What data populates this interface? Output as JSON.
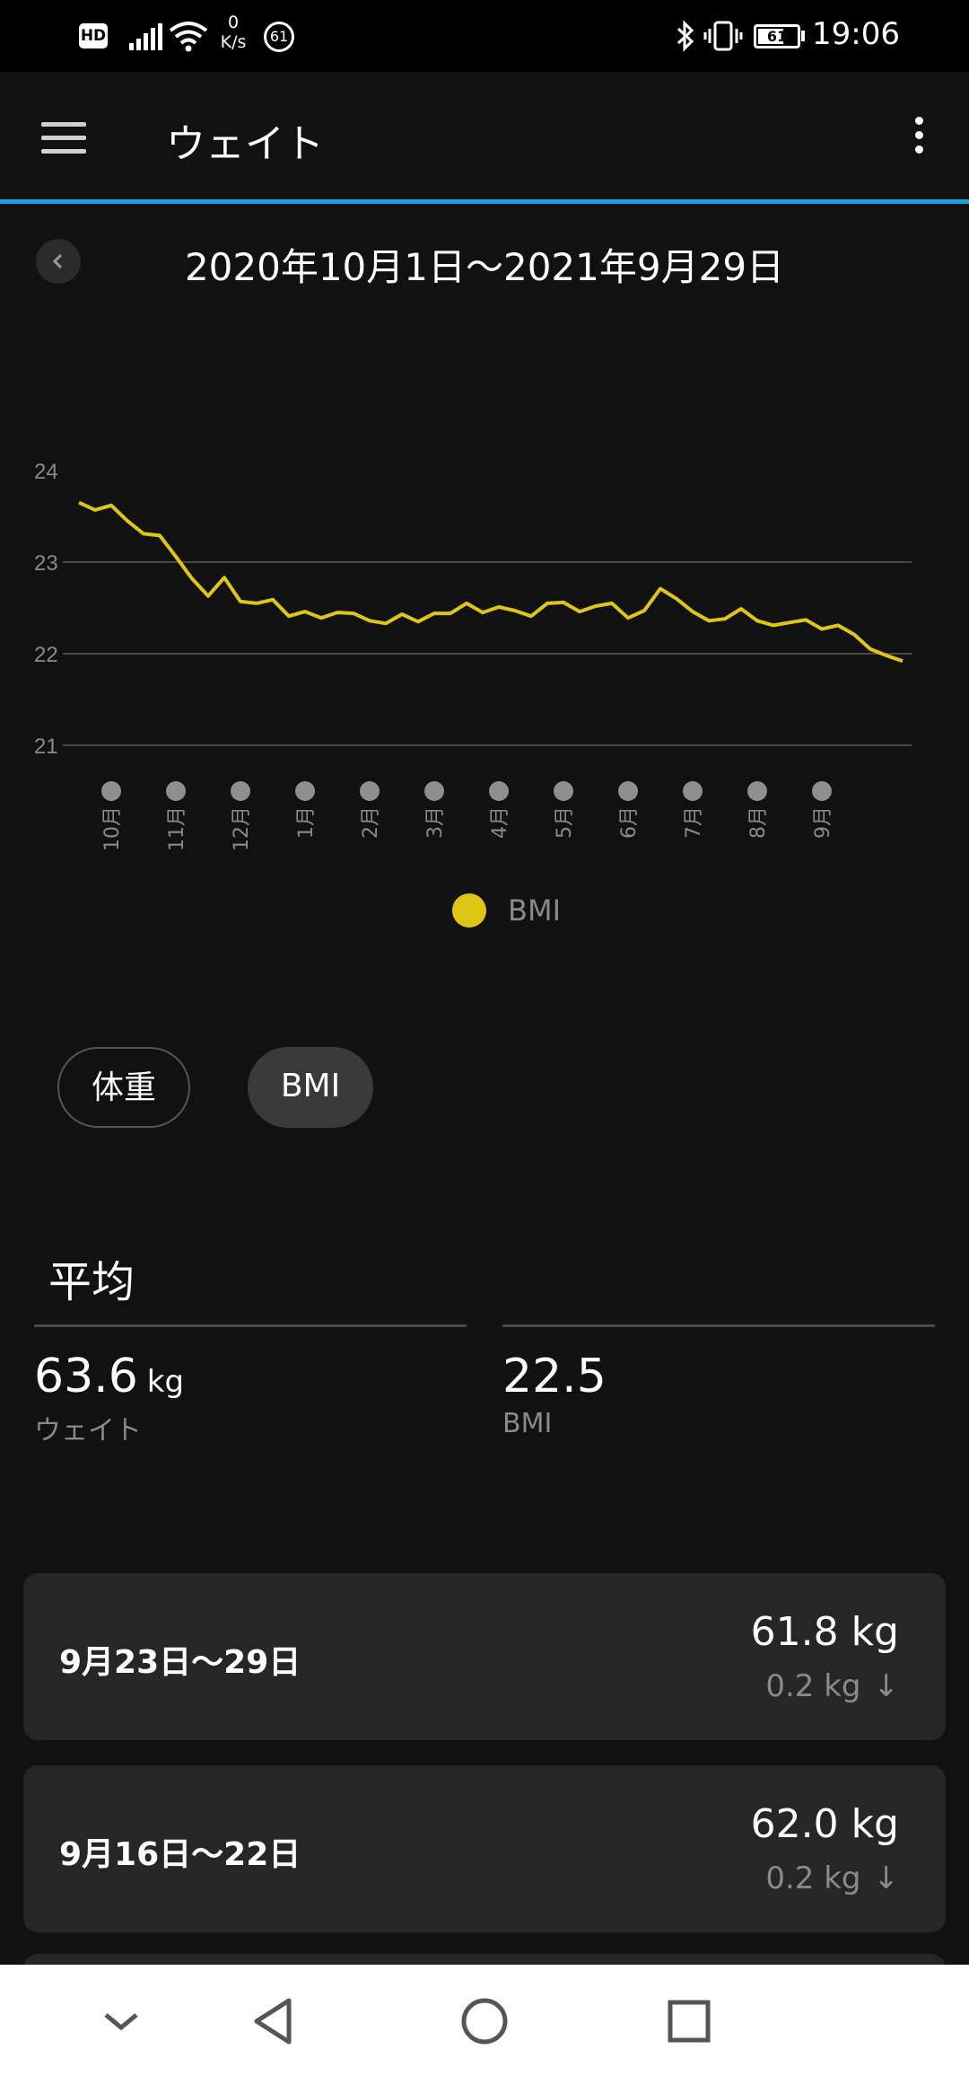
{
  "status_bar": {
    "hd_badge": "HD",
    "net_speed_value": "0",
    "net_speed_unit": "K/s",
    "notification_count": "61",
    "battery_level": "61",
    "time": "19:06"
  },
  "app_bar": {
    "title": "ウェイト"
  },
  "date_range": "2020年10月1日～2021年9月29日",
  "chart_data": {
    "type": "line",
    "y_ticks": [
      "24",
      "23",
      "22",
      "21"
    ],
    "ylim": [
      21,
      24
    ],
    "grid": true,
    "legend": [
      {
        "label": "BMI",
        "color": "#e0c614"
      }
    ],
    "x_ticks": [
      "10月",
      "11月",
      "12月",
      "1月",
      "2月",
      "3月",
      "4月",
      "5月",
      "6月",
      "7月",
      "8月",
      "9月"
    ],
    "series": [
      {
        "name": "BMI",
        "color": "#e0c614",
        "values": [
          23.65,
          23.57,
          23.62,
          23.45,
          23.31,
          23.29,
          23.06,
          22.82,
          22.63,
          22.83,
          22.57,
          22.55,
          22.59,
          22.41,
          22.46,
          22.39,
          22.45,
          22.44,
          22.36,
          22.33,
          22.43,
          22.35,
          22.44,
          22.44,
          22.55,
          22.45,
          22.51,
          22.47,
          22.41,
          22.55,
          22.56,
          22.46,
          22.52,
          22.55,
          22.39,
          22.47,
          22.71,
          22.6,
          22.46,
          22.36,
          22.38,
          22.49,
          22.36,
          22.31,
          22.34,
          22.37,
          22.27,
          22.31,
          22.21,
          22.05,
          21.98,
          21.92
        ]
      }
    ]
  },
  "toggles": {
    "weight_label": "体重",
    "bmi_label": "BMI"
  },
  "averages": {
    "title": "平均",
    "weight_value": "63.6",
    "weight_unit": "kg",
    "weight_label": "ウェイト",
    "bmi_value": "22.5",
    "bmi_label": "BMI"
  },
  "weeks": [
    {
      "label": "9月23日～29日",
      "value": "61.8 kg",
      "delta": "0.2 kg"
    },
    {
      "label": "9月16日～22日",
      "value": "62.0 kg",
      "delta": "0.2 kg"
    }
  ],
  "colors": {
    "background": "#111111",
    "accent": "#1e9ede",
    "bmi_line": "#e0c614",
    "card": "#262626"
  }
}
